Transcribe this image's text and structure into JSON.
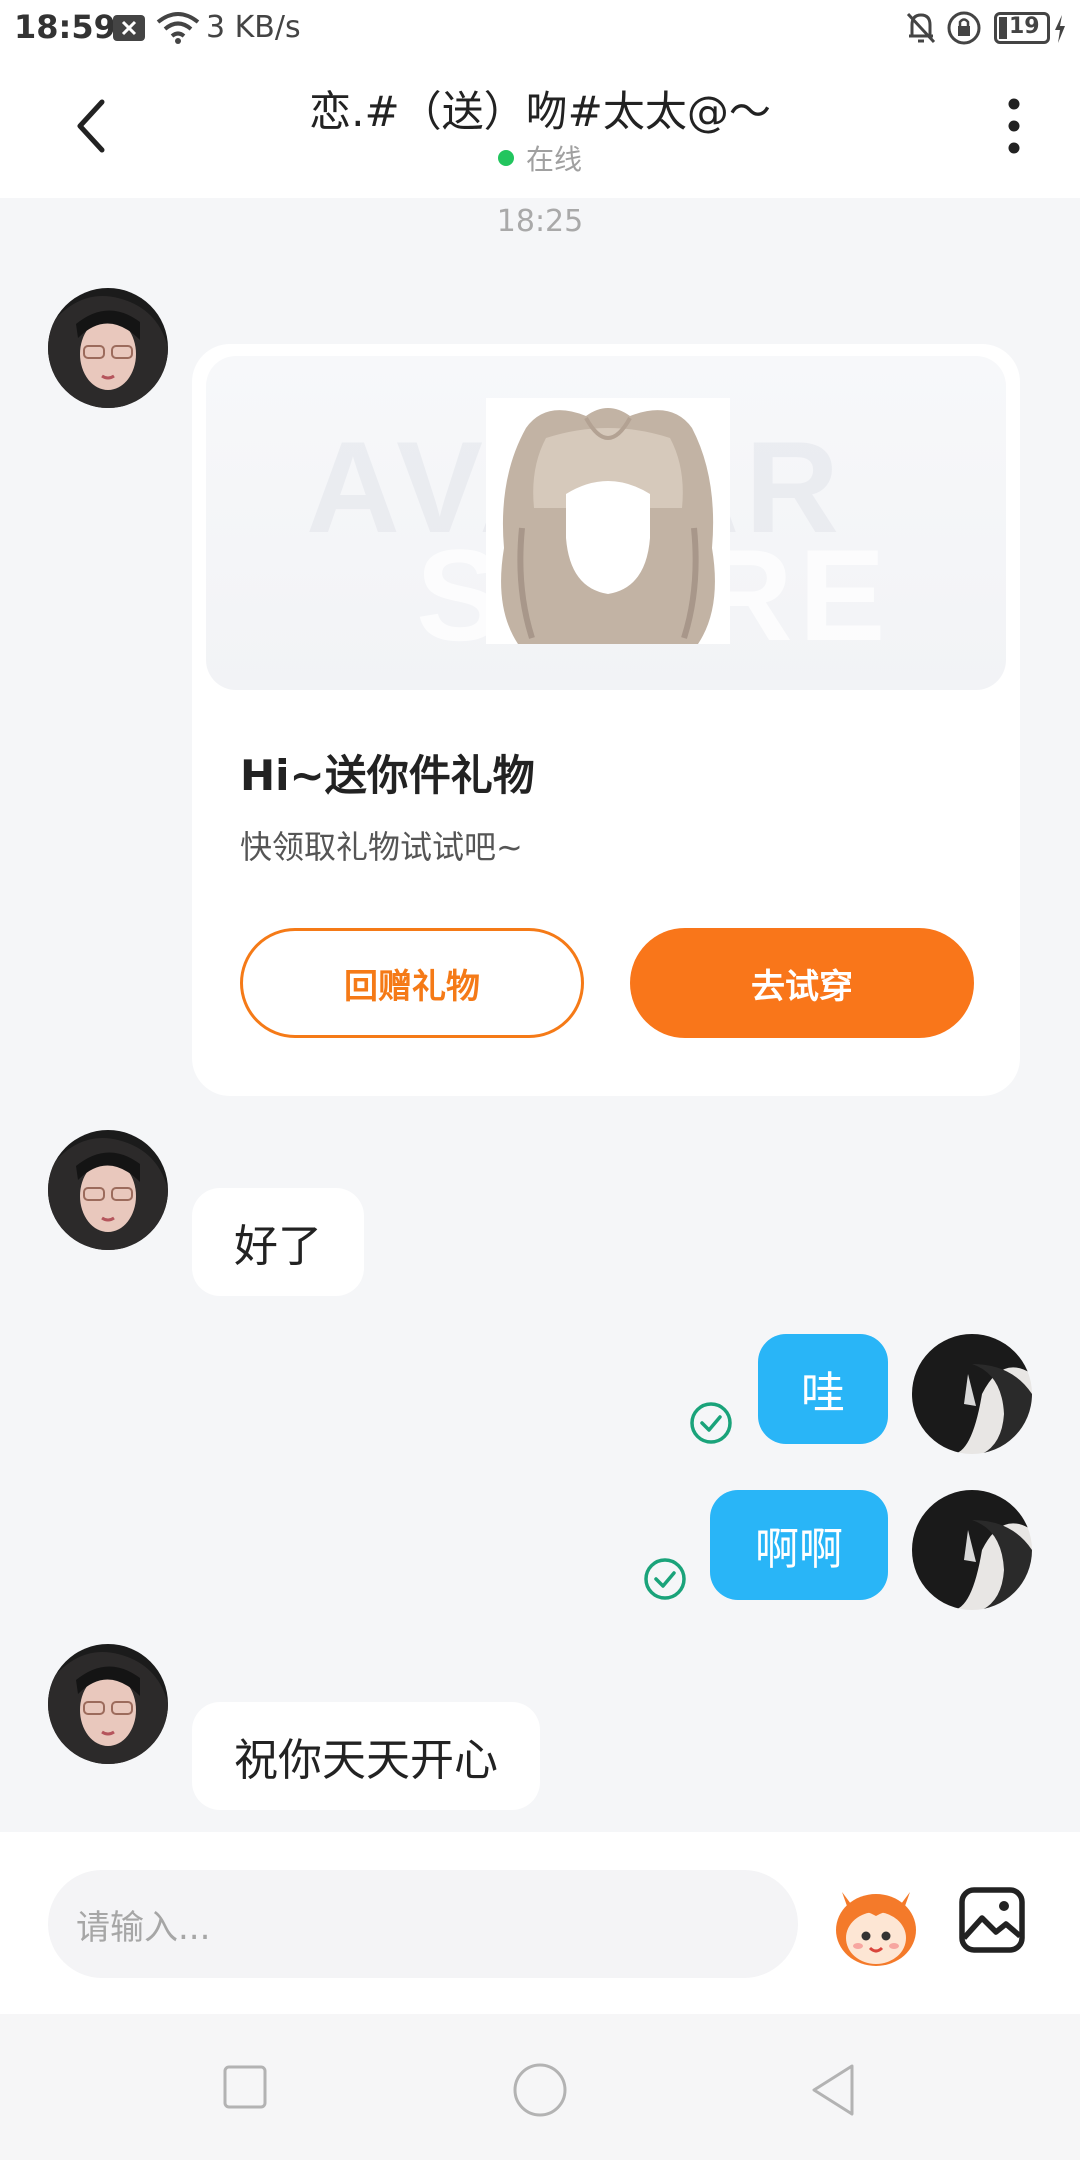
{
  "status_bar": {
    "time": "18:59",
    "net_speed": "3 KB/s",
    "battery": "19"
  },
  "header": {
    "title": "恋.#（送）吻#太太@～",
    "status": "在线"
  },
  "messages": {
    "timestamp": "18:25",
    "gift_card": {
      "watermark_line1": "AVATAR",
      "watermark_line2": "STORE",
      "title": "Hi~送你件礼物",
      "subtitle": "快领取礼物试试吧~",
      "return_gift_label": "回赠礼物",
      "try_on_label": "去试穿"
    },
    "msg_1": "好了",
    "msg_2": "哇",
    "msg_3": "啊啊",
    "msg_4": "祝你天天开心"
  },
  "input_bar": {
    "placeholder": "请输入..."
  },
  "colors": {
    "accent_orange": "#f9761a",
    "outgoing_bubble": "#29b5f7",
    "online_green": "#22c55e",
    "read_check": "#1aa37a"
  }
}
